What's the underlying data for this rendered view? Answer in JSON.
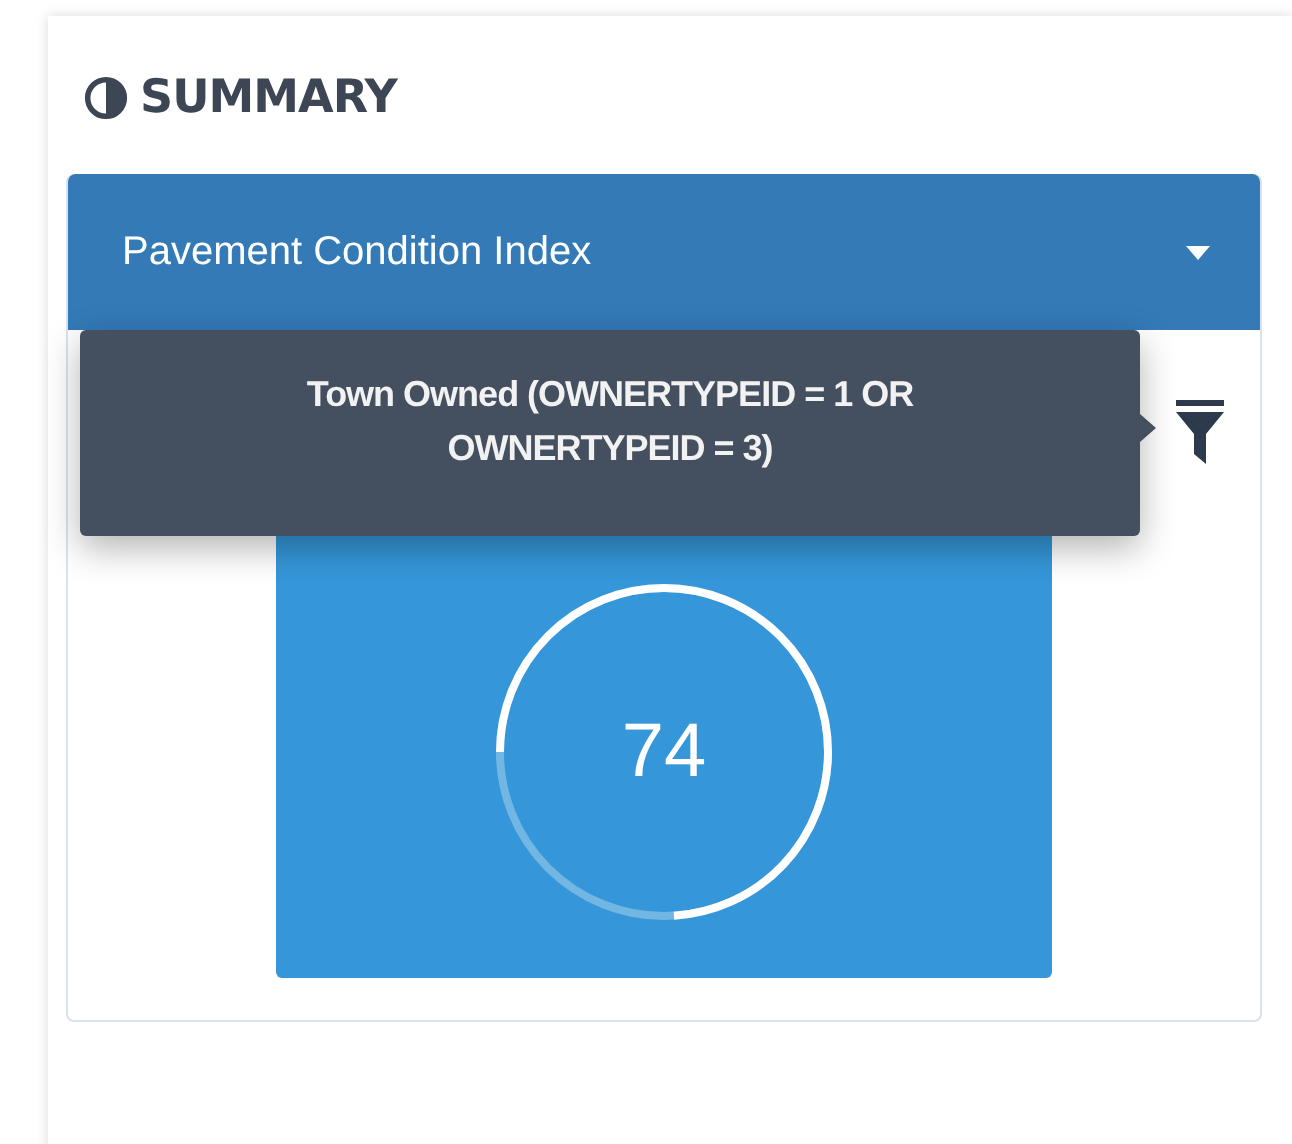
{
  "panel": {
    "title": "SUMMARY"
  },
  "dropdown": {
    "value": "Pavement Condition Index"
  },
  "tooltip": {
    "text": "Town Owned (OWNERTYPEID = 1 OR OWNERTYPEID = 3)"
  },
  "tile": {
    "value": "74",
    "level": 0.74
  }
}
